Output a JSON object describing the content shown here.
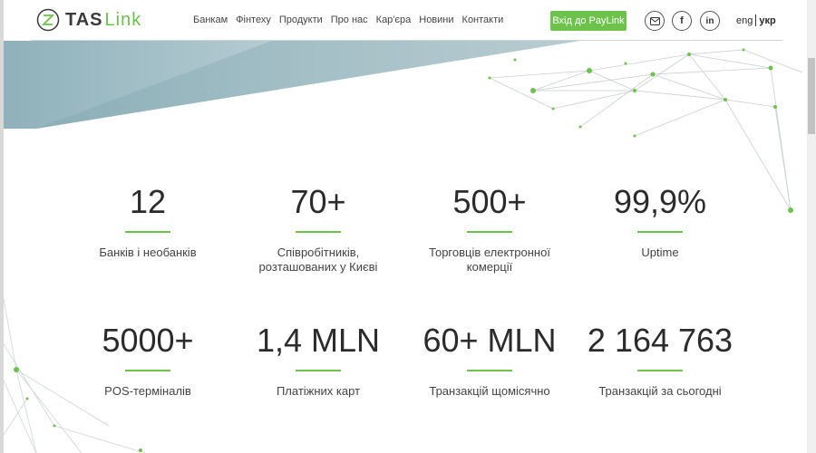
{
  "brand": {
    "logo_bold": "TAS",
    "logo_light": "Link"
  },
  "nav": [
    "Банкам",
    "Фінтеху",
    "Продукти",
    "Про нас",
    "Кар'єра",
    "Новини",
    "Контакти"
  ],
  "cta_label": "Вхід до PayLink",
  "social_icons": [
    "email-icon",
    "facebook-icon",
    "linkedin-icon"
  ],
  "lang": {
    "eng": "eng",
    "ukr": "укр",
    "active": "укр"
  },
  "colors": {
    "accent": "#6cc24a",
    "banner": "#a9c3ca",
    "text": "#2b2b2b"
  },
  "stats": [
    {
      "value": "12",
      "label": "Банків і необанків"
    },
    {
      "value": "70+",
      "label": "Співробітників, розташованих у Києві"
    },
    {
      "value": "500+",
      "label": "Торговців електронної комерції"
    },
    {
      "value": "99,9%",
      "label": "Uptime"
    },
    {
      "value": "5000+",
      "label": "POS-терміналів"
    },
    {
      "value": "1,4 MLN",
      "label": "Платіжних карт"
    },
    {
      "value": "60+ MLN",
      "label": "Транзакцій щомісячно"
    },
    {
      "value": "2 164 763",
      "label": "Транзакцій за сьогодні"
    }
  ]
}
